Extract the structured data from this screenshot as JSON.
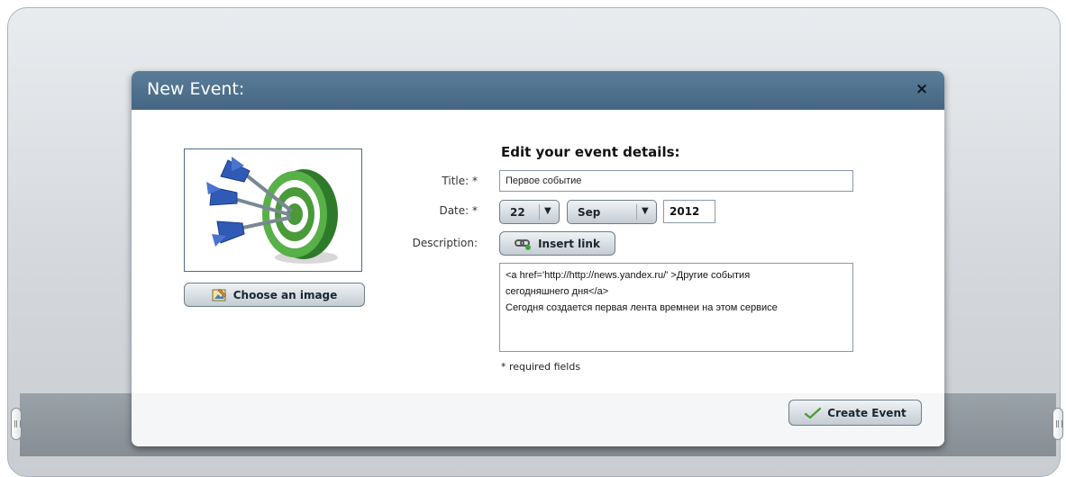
{
  "dialog": {
    "title": "New Event:",
    "close_label": "×"
  },
  "image_panel": {
    "choose_image_label": "Choose an image",
    "image_subject": "darts hitting target"
  },
  "form": {
    "heading": "Edit your event details:",
    "title_label": "Title: *",
    "title_value": "Первое событие",
    "date_label": "Date: *",
    "day_value": "22",
    "month_value": "Sep",
    "year_value": "2012",
    "description_label": "Description:",
    "insert_link_label": "Insert link",
    "description_lines": [
      "<a href='http://http://news.yandex.ru/' >Другие события",
      "сегодняшнего дня</a>",
      "Сегодня создается первая лента времнеи на этом сервисе"
    ],
    "required_note": "* required fields"
  },
  "footer": {
    "create_event_label": "Create Event"
  },
  "colors": {
    "header": "#4f728f",
    "accent_green": "#4a9a3a",
    "dart_blue": "#2f5bb7"
  }
}
